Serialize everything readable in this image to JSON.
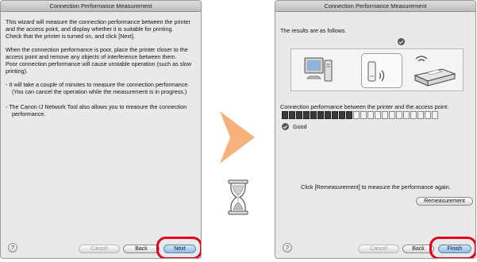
{
  "wizard_step1": {
    "title": "Connection Performance Measurement",
    "paragraph1": "This wizard will measure the connection performance between the printer and the access point, and display whether it is suitable for printing.\nCheck that the printer is turned on, and click [Next].",
    "paragraph2": "When the connection performance is poor, place the printer closer to the access point and remove any objects of interference between them.\nPoor connection performance will cause unstable operation (such as slow printing).",
    "bullet1": "- It will take a couple of minutes to measure the connection performance.\n(You can cancel the operation while the measurement is in progress.)",
    "bullet2": "- The Canon IJ Network Tool also allows you to measure the connection performance.",
    "buttons": {
      "help": "?",
      "cancel": "Cancel",
      "back": "Back",
      "next": "Next"
    }
  },
  "wizard_step2": {
    "title": "Connection Performance Measurement",
    "results_label": "The results are as follows.",
    "connection_label": "Connection performance between the printer and the access point:",
    "signal_level": {
      "filled": 10,
      "total": 22
    },
    "status_text": "Good",
    "remeasure_text": "Click [Remeasurement] to measure the performance again.",
    "buttons": {
      "help": "?",
      "cancel": "Cancel",
      "back": "Back",
      "finish": "Finish",
      "remeasurement": "Remeasurement"
    }
  },
  "colors": {
    "highlight": "#e2001a",
    "arrow": "#f6b27a",
    "default_button": "#8ebde6"
  },
  "icons": [
    "computer-icon",
    "access-point-icon",
    "printer-icon",
    "check-icon",
    "help-icon",
    "arrow-right-icon",
    "hourglass-icon"
  ]
}
